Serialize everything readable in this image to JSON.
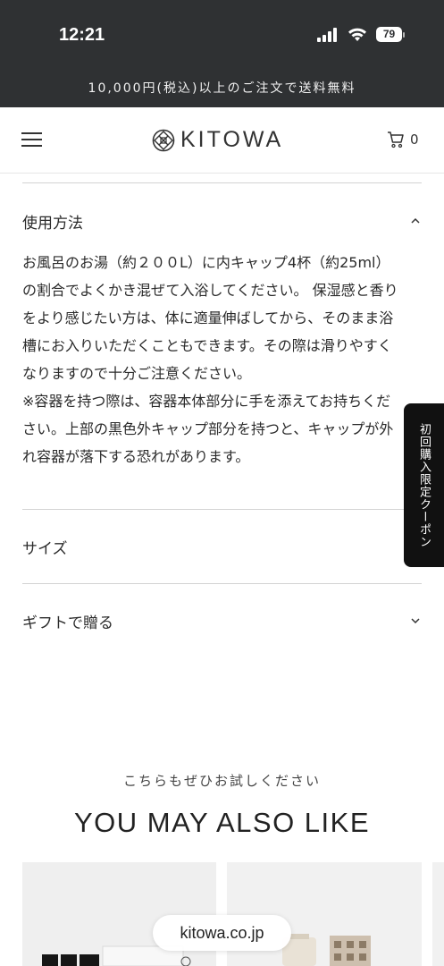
{
  "status_bar": {
    "time": "12:21",
    "battery": "79",
    "icons": [
      "signal-icon",
      "wifi-icon",
      "battery-icon"
    ]
  },
  "announcement": "10,000円(税込)以上のご注文で送料無料",
  "header": {
    "logo": "KITOWA",
    "cart_count": "0"
  },
  "accordion": [
    {
      "title": "使用方法",
      "expanded": true
    },
    {
      "title": "サイズ",
      "expanded": false
    },
    {
      "title": "ギフトで贈る",
      "expanded": false
    }
  ],
  "usage_text": [
    "お風呂のお湯（約２００L）に内キャップ4杯（約25ml）",
    "の割合でよくかき混ぜて入浴してください。 保湿感と香り",
    "をより感じたい方は、体に適量伸ばしてから、そのまま浴",
    "槽にお入りいただくこともできます。その際は滑りやすく",
    "なりますので十分ご注意ください。",
    "※容器を持つ際は、容器本体部分に手を添えてお持ちくだ",
    "さい。上部の黒色外キャップ部分を持つと、キャップが外",
    "れ容器が落下する恐れがあります。"
  ],
  "coupon_tab": "初回購入限定クーポン",
  "recommend": {
    "subtitle": "こちらもぜひお試しください",
    "heading": "YOU MAY ALSO LIKE"
  },
  "url_bar": "kitowa.co.jp"
}
